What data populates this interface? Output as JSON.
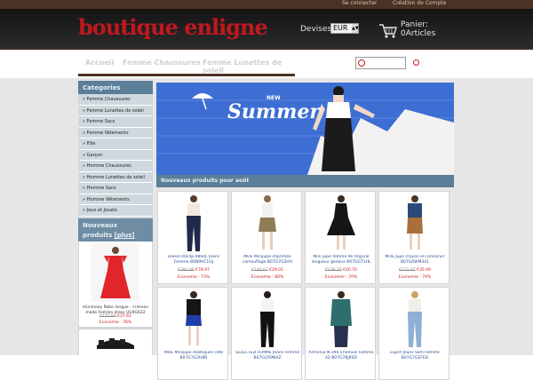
{
  "top_links": {
    "login": "Se connecter",
    "create_account": "Création de Compte"
  },
  "logo": {
    "text": "boutique enligne",
    "color": "#c0181f"
  },
  "currency": {
    "label": "Devises:",
    "selected": "EUR"
  },
  "cart": {
    "label": "Panier:",
    "count": "0Articles"
  },
  "nav": {
    "items": [
      "Accueil",
      "Femme Chaussures",
      "Femme Lunettes de soleil"
    ]
  },
  "search": {
    "placeholder": ""
  },
  "sidebar": {
    "categories_title": "Categories",
    "categories": [
      "» Femme Chaussures",
      "» Femme Lunettes de soleil",
      "» Femme Sacs",
      "» Femme Vêtements",
      "» Fille",
      "» Garçon",
      "» Homme Chaussures",
      "» Homme Lunettes de soleil",
      "» Homme Sacs",
      "» Homme Vêtements",
      "» Jeux et Jouets"
    ],
    "new_title": "Nouveaux produits",
    "new_more": "[plus]",
    "featured": {
      "name": "minimoey Robe longue - crimson mode Femme dress UU4G622",
      "old_price": "€155.60",
      "new_price": "€37.61",
      "economy": "Economie : 76%"
    }
  },
  "banner": {
    "new": "NEW",
    "title": "Summer"
  },
  "products_title": "Nouveaux produits pour août",
  "products": [
    {
      "name": "Diesel 00cdp-0860L Jeans Femme B0N9VC1GJ",
      "old": "€281.00",
      "new": "€78.97",
      "eco": "Economie : 73%"
    },
    {
      "name": "MOE Minijupe imprimée camouflage B07G7G2HH",
      "old": "€146.62",
      "new": "€29.01",
      "eco": "Economie : 80%"
    },
    {
      "name": "Mini Jupe femme de tropical longueur genoux B07GGT1HL",
      "old": "€136.20",
      "new": "€40.70",
      "eco": "Economie : 70%"
    },
    {
      "name": "MOE Jupe crayon en similicuir B07G0WM341",
      "old": "€132.87",
      "new": "€35.09",
      "eco": "Economie : 74%"
    },
    {
      "name": "MOE Minijupe élastiques côté B07G7G2H8R",
      "old": "",
      "new": "",
      "eco": ""
    },
    {
      "name": "SELECTED FEMME Jeans Femme B07GCR9NXZ",
      "old": "",
      "new": "",
      "eco": ""
    },
    {
      "name": "Armenia N 390 Chemise Femme 42 B07G7BJ9SD",
      "old": "",
      "new": "",
      "eco": ""
    },
    {
      "name": "Esprit Jeans Slim Femme B07G7GEFED",
      "old": "",
      "new": "",
      "eco": ""
    }
  ]
}
